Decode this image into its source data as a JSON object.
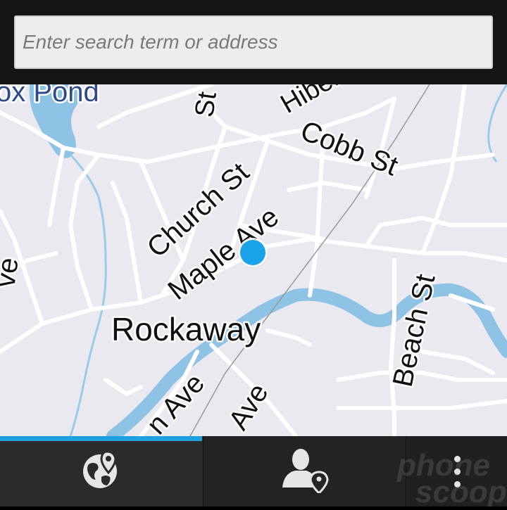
{
  "search": {
    "placeholder": "Enter search term or address"
  },
  "map": {
    "labels": {
      "fox_pond": "ox Pond",
      "st_top": "St",
      "hibernia": "Hibern",
      "cobb_st": "Cobb St",
      "church_st": "Church St",
      "maple_ave": "Maple Ave",
      "ave_left": "ve",
      "rockaway": "Rockaway",
      "beach_st": "Beach St",
      "n_ave": "n Ave",
      "ave_bottom": "Ave"
    },
    "colors": {
      "land": "#e9e9ef",
      "road": "#ffffff",
      "water": "#8ec3e6",
      "location_dot": "#1aa3e8"
    }
  },
  "bottom_bar": {
    "tabs": [
      {
        "icon": "globe-pin-icon",
        "active": true
      },
      {
        "icon": "person-pin-icon",
        "active": false
      },
      {
        "icon": "overflow-menu-icon",
        "active": false
      }
    ],
    "active_indicator_color": "#1ca0e0"
  },
  "watermark": {
    "logo": "Phone Scoop"
  }
}
